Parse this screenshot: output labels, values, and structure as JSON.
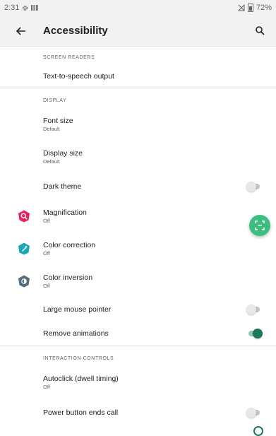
{
  "status": {
    "time": "2:31",
    "battery": "72%"
  },
  "header": {
    "title": "Accessibility"
  },
  "sections": {
    "screen_readers": "SCREEN READERS",
    "display": "DISPLAY",
    "interaction": "INTERACTION CONTROLS"
  },
  "items": {
    "tts": {
      "label": "Text-to-speech output"
    },
    "font_size": {
      "label": "Font size",
      "sub": "Default"
    },
    "display_size": {
      "label": "Display size",
      "sub": "Default"
    },
    "dark_theme": {
      "label": "Dark theme",
      "on": false
    },
    "magnification": {
      "label": "Magnification",
      "sub": "Off",
      "icon_color": "#e8245c"
    },
    "color_correction": {
      "label": "Color correction",
      "sub": "Off",
      "icon_color": "#1aa6b7"
    },
    "color_inversion": {
      "label": "Color inversion",
      "sub": "Off",
      "icon_color": "#546e7a"
    },
    "large_pointer": {
      "label": "Large mouse pointer",
      "on": false
    },
    "remove_animations": {
      "label": "Remove animations",
      "on": true
    },
    "autoclick": {
      "label": "Autoclick (dwell timing)",
      "sub": "Off"
    },
    "power_button": {
      "label": "Power button ends call",
      "on": false
    }
  },
  "colors": {
    "accent": "#1a7a57",
    "fab": "#3ebd83"
  }
}
